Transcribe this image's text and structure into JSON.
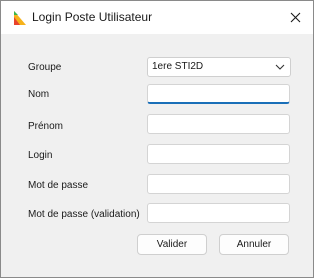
{
  "window": {
    "title": "Login Poste Utilisateur",
    "app_icon": "chart-pyramid-icon",
    "close_icon": "close-icon"
  },
  "form": {
    "groupe_label": "Groupe",
    "groupe_value": "1ere STI2D",
    "nom_label": "Nom",
    "nom_value": "",
    "prenom_label": "Prénom",
    "prenom_value": "",
    "login_label": "Login",
    "login_value": "",
    "mdp_label": "Mot de passe",
    "mdp_value": "",
    "mdp_valid_label": "Mot de passe (validation)",
    "mdp_valid_value": ""
  },
  "buttons": {
    "valider": "Valider",
    "annuler": "Annuler"
  },
  "colors": {
    "focus_underline": "#1a6fb8"
  }
}
